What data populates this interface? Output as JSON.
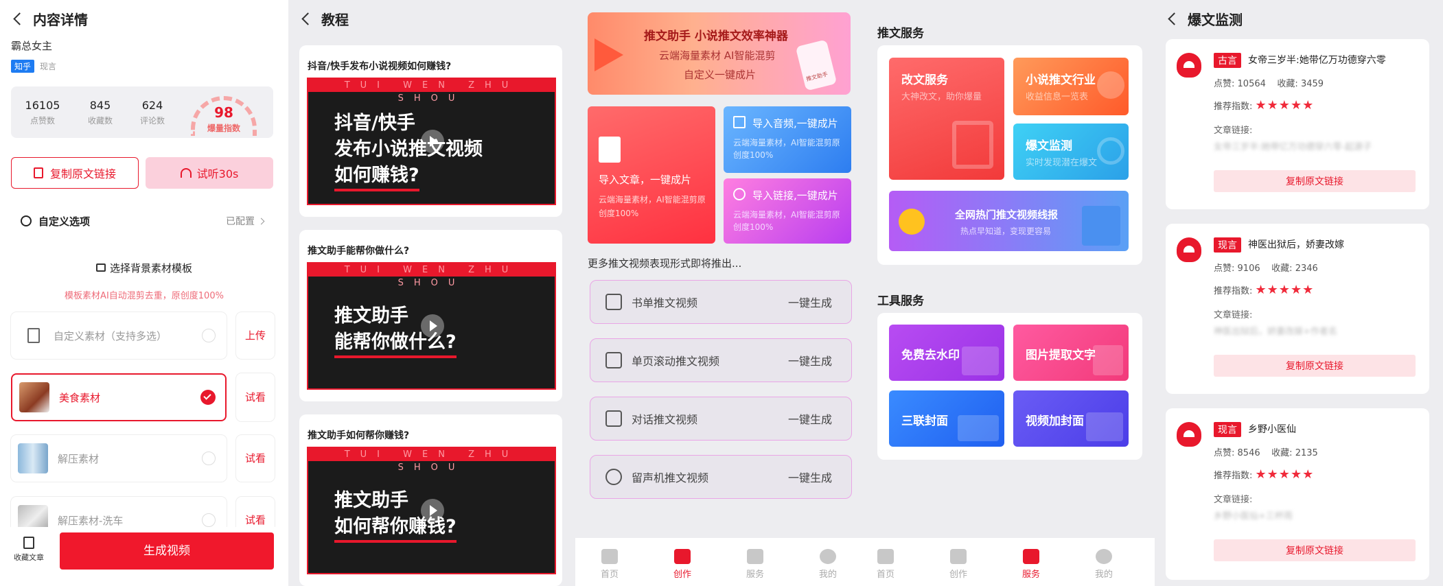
{
  "p1": {
    "title": "内容详情",
    "author": "霸总女主",
    "tag1": "知乎",
    "tag2": "现言",
    "stats": [
      {
        "v": "16105",
        "l": "点赞数"
      },
      {
        "v": "845",
        "l": "收藏数"
      },
      {
        "v": "624",
        "l": "评论数"
      }
    ],
    "score": "98",
    "score_label": "爆量指数",
    "copy_btn": "复制原文链接",
    "listen_btn": "试听30s",
    "custom_label": "自定义选项",
    "custom_status": "已配置",
    "bg_title": "选择背景素材模板",
    "bg_hint": "模板素材AI自动混剪去重，原创度100%",
    "materials": [
      {
        "name": "自定义素材（支持多选）",
        "action": "上传"
      },
      {
        "name": "美食素材",
        "action": "试看"
      },
      {
        "name": "解压素材",
        "action": "试看"
      },
      {
        "name": "解压素材-洗车",
        "action": "试看"
      }
    ],
    "save_label": "收藏文章",
    "gen_btn": "生成视频"
  },
  "p2": {
    "title": "教程",
    "band": "TUI WEN ZHU SHOU",
    "items": [
      {
        "q": "抖音/快手发布小说视频如何赚钱?",
        "l1": "抖音/快手",
        "l2": "发布小说推文视频",
        "l3": "如何赚钱?"
      },
      {
        "q": "推文助手能帮你做什么?",
        "l1": "推文助手",
        "l2": "能帮你做什么?"
      },
      {
        "q": "推文助手如何帮你赚钱?",
        "l1": "推文助手",
        "l2": "如何帮你赚钱?"
      }
    ]
  },
  "p3": {
    "banner_title": "推文助手 小说推文效率神器",
    "banner_sub1": "云端海量素材 AI智能混剪",
    "banner_sub2": "自定义一键成片",
    "banner_phone": "推文助手",
    "import_article": "导入文章，一键成片",
    "import_article_desc": "云端海量素材，AI智能混剪原创度100%",
    "import_audio": "导入音频,一键成片",
    "import_audio_desc": "云端海量素材，AI智能混剪原创度100%",
    "import_link": "导入链接,一键成片",
    "import_link_desc": "云端海量素材，AI智能混剪原创度100%",
    "more": "更多推文视频表现形式即将推出...",
    "list": [
      {
        "name": "书单推文视频",
        "act": "一键生成"
      },
      {
        "name": "单页滚动推文视频",
        "act": "一键生成"
      },
      {
        "name": "对话推文视频",
        "act": "一键生成"
      },
      {
        "name": "留声机推文视频",
        "act": "一键生成"
      }
    ],
    "tabs": [
      "首页",
      "创作",
      "服务",
      "我的"
    ]
  },
  "p4": {
    "sec1": "推文服务",
    "rewrite": "改文服务",
    "rewrite_desc": "大神改文，助你爆量",
    "industry": "小说推文行业",
    "industry_desc": "收益信息一览表",
    "monitor": "爆文监测",
    "monitor_desc": "实时发现潜在爆文",
    "banner": "全网热门推文视频线报",
    "banner_sub": "热点早知道，变现更容易",
    "sec2": "工具服务",
    "tools": [
      "免费去水印",
      "图片提取文字",
      "三联封面",
      "视频加封面"
    ],
    "tabs": [
      "首页",
      "创作",
      "服务",
      "我的"
    ]
  },
  "p5": {
    "title": "爆文监测",
    "stat_like": "点赞:",
    "stat_fav": "收藏:",
    "rate_label": "推荐指数:",
    "link_label": "文章链接:",
    "copy": "复制原文链接",
    "items": [
      {
        "tag": "古言",
        "title": "女帝三岁半:她带亿万功德穿六零",
        "like": "10564",
        "fav": "3459",
        "link": "女帝三岁半:她带亿万功德穿六零-起源子"
      },
      {
        "tag": "现言",
        "title": "神医出狱后，娇妻改嫁",
        "like": "9106",
        "fav": "2346",
        "link": "神医出狱后，娇妻改嫁+作者名"
      },
      {
        "tag": "现言",
        "title": "乡野小医仙",
        "like": "8546",
        "fav": "2135",
        "link": "乡野小医仙+三杯雨"
      }
    ]
  },
  "colors": {
    "accent": "#e8182c"
  }
}
